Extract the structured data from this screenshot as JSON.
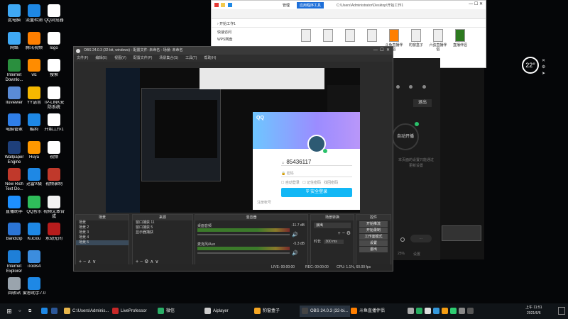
{
  "desktop_icons": [
    {
      "label": "此电脑",
      "color": "#3fa9f5"
    },
    {
      "label": "网络",
      "color": "#3fa9f5"
    },
    {
      "label": "Internet Downlo...",
      "color": "#2a8f3e"
    },
    {
      "label": "Iluviewer",
      "color": "#5a8bd6"
    },
    {
      "label": "电脑管家",
      "color": "#2f7fe8"
    },
    {
      "label": "Wallpaper Engine",
      "color": "#1e3f7a"
    },
    {
      "label": "New Rich Text Do...",
      "color": "#c0392b"
    },
    {
      "label": "直播助手",
      "color": "#1e90ff"
    },
    {
      "label": "Bandizip",
      "color": "#2b75d6"
    },
    {
      "label": "Internet Explorer",
      "color": "#1e7fd8"
    },
    {
      "label": "回收站",
      "color": "#9aa4ad"
    },
    {
      "label": "流量检测",
      "color": "#1e88e5"
    },
    {
      "label": "腾讯视频",
      "color": "#ff7f00"
    },
    {
      "label": "vlc",
      "color": "#ff8c00"
    },
    {
      "label": "YY语音",
      "color": "#f5b800"
    },
    {
      "label": "酷狗",
      "color": "#1e88e5"
    },
    {
      "label": "Huya",
      "color": "#ff9800"
    },
    {
      "label": "迅雷X极",
      "color": "#1e88e5"
    },
    {
      "label": "QQ音乐",
      "color": "#2fbd5a"
    },
    {
      "label": "KuGou",
      "color": "#1e88e5"
    },
    {
      "label": "iTools4",
      "color": "#3c8dde"
    },
    {
      "label": "爱思助手7.0",
      "color": "#1e88e5"
    },
    {
      "label": "QQ浏览器",
      "color": "#fff"
    },
    {
      "label": "logo",
      "color": "#fff"
    },
    {
      "label": "搜索",
      "color": "#fff"
    },
    {
      "label": "TP-LINK安防系统",
      "color": "#fff"
    },
    {
      "label": "开始工作1",
      "color": "#fff"
    },
    {
      "label": "视频",
      "color": "#fff"
    },
    {
      "label": "视频录制",
      "color": "#c0392b"
    },
    {
      "label": "视频文本合成",
      "color": "#f2f2f2"
    },
    {
      "label": "永劫无间",
      "color": "#b71c1c"
    }
  ],
  "explorer": {
    "tabs": [
      "管理",
      "应用程序工具"
    ],
    "path": "C:\\Users\\Administrator\\Desktop\\开始工作1",
    "address": "开始工作1",
    "nav": [
      "快速访问",
      "WPS网盘"
    ],
    "files": [
      "",
      "",
      "",
      "",
      "斗鱼直播伴侣",
      "豹窗盒子",
      "六弦直播伴侣",
      "直播伴侣"
    ],
    "accent": "#1e6fd9"
  },
  "obs": {
    "title": "OBS 24.0.3 (32-bit, windows) - 配置文件: 未命名 - 场景: 未命名",
    "menu": [
      "文件(F)",
      "编辑(E)",
      "视图(V)",
      "配置文件(P)",
      "场景集合(S)",
      "工具(T)",
      "帮助(H)"
    ],
    "docks": {
      "scenes": {
        "header": "场景",
        "items": [
          "场景",
          "场景 2",
          "场景 3",
          "场景 4",
          "场景 5"
        ]
      },
      "sources": {
        "header": "来源",
        "items": [
          "窗口捕获 11",
          "窗口捕获 5",
          "显示器捕获"
        ]
      },
      "mixer": {
        "header": "混音器",
        "desktop_audio": "桌面音频",
        "desktop_db": "-11.7 dB",
        "mic": "麦克风/Aux",
        "mic_db": "-5.3 dB"
      },
      "transitions": {
        "header": "场景转换",
        "fade": "淡出",
        "duration_label": "时长",
        "duration": "300 ms"
      },
      "controls": {
        "header": "控件",
        "buttons": [
          "开始推流",
          "开始录制",
          "工作室模式",
          "设置",
          "退出"
        ]
      }
    },
    "status": {
      "live": "LIVE: 00:00:00",
      "rec": "REC: 00:00:00",
      "cpu": "CPU: 1.1%, 60.00 fps"
    }
  },
  "qq": {
    "brand": "QQ",
    "account": "85436117",
    "password_placeholder": "密码",
    "auto_login": "自动登录",
    "remember": "记住密码",
    "forgot": "找回密码",
    "login_button": "安全登录",
    "register": "注册帐号"
  },
  "dark_app": {
    "exit_label": "退出",
    "start_label": "自动开播",
    "hint1": "本页面的设置只能通过",
    "hint2": "更新设置",
    "tail": "...",
    "percent": "25%",
    "settings_label": "设置"
  },
  "weather": {
    "temp": "22°"
  },
  "taskbar": {
    "apps": [
      {
        "label": "C:\\Users\\Adminis...",
        "color": "#e8b64a"
      },
      {
        "label": "LiveProfessor",
        "color": "#c62828"
      },
      {
        "label": "微信",
        "color": "#2aae67"
      },
      {
        "label": "Aiplayer",
        "color": "#cccccc"
      },
      {
        "label": "豹窗盒子",
        "color": "#f5a623"
      },
      {
        "label": "OBS 24.0.3 (32-bi...",
        "color": "#444444"
      },
      {
        "label": "斗鱼直播伴侣",
        "color": "#ff7f00"
      }
    ],
    "time": "上午 11:51",
    "date": "2021/6/6"
  }
}
